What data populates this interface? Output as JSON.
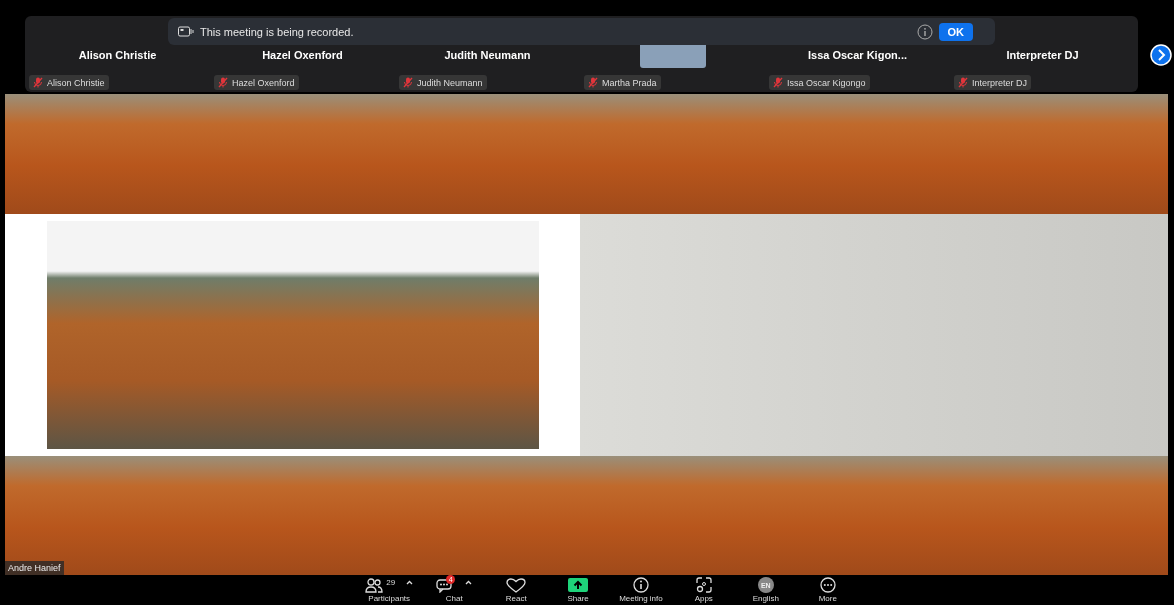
{
  "recording_banner": {
    "message": "This meeting is being recorded.",
    "button": "OK"
  },
  "participants": [
    {
      "name": "Alison Christie",
      "label": "Alison Christie",
      "muted": true,
      "video": false
    },
    {
      "name": "Hazel Oxenford",
      "label": "Hazel Oxenford",
      "muted": true,
      "video": false
    },
    {
      "name": "Judith Neumann",
      "label": "Judith Neumann",
      "muted": true,
      "video": false
    },
    {
      "label": "Martha Prada",
      "muted": true,
      "video": true
    },
    {
      "name": "Issa Oscar Kigon...",
      "label": "Issa Oscar Kigongo",
      "muted": true,
      "video": false
    },
    {
      "name": "Interpreter DJ",
      "label": "Interpreter DJ",
      "muted": true,
      "video": false
    }
  ],
  "main_video": {
    "speaker": "Andre Hanief"
  },
  "toolbar": [
    {
      "kind": "participants",
      "label": "Participants",
      "count": "29",
      "caret": true
    },
    {
      "kind": "chat",
      "label": "Chat",
      "badge": "4",
      "caret": true
    },
    {
      "kind": "react",
      "label": "React",
      "caret": false
    },
    {
      "kind": "share",
      "label": "Share",
      "caret": false
    },
    {
      "kind": "info",
      "label": "Meeting info",
      "caret": false
    },
    {
      "kind": "apps",
      "label": "Apps",
      "caret": false
    },
    {
      "kind": "language",
      "label": "English",
      "code": "EN",
      "caret": false
    },
    {
      "kind": "more",
      "label": "More",
      "caret": false
    }
  ]
}
